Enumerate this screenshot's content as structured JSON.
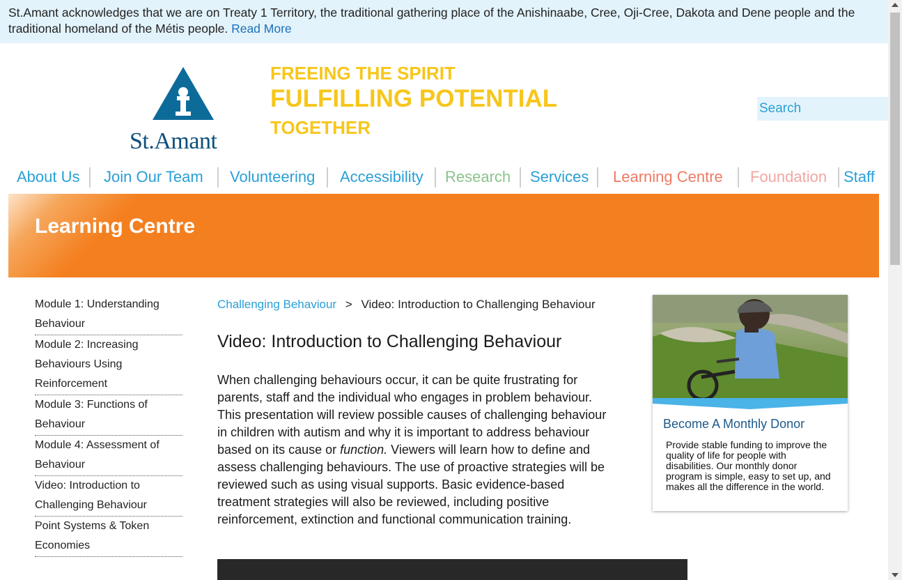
{
  "acknowledgement": {
    "text": "St.Amant acknowledges that we are on Treaty 1 Territory, the traditional gathering place of the Anishinaabe, Cree, Oji-Cree, Dakota and Dene people and the traditional homeland of the Métis people.",
    "link_label": "Read More"
  },
  "logo": {
    "wordmark": "St.Amant"
  },
  "tagline": {
    "line1": "FREEING THE SPIRIT",
    "line2": "FULFILLING POTENTIAL",
    "line3": "TOGETHER"
  },
  "search": {
    "placeholder": "Search"
  },
  "nav": {
    "items": [
      {
        "label": "About Us",
        "color": "#2a9fd6"
      },
      {
        "label": "Join Our Team",
        "color": "#2a9fd6"
      },
      {
        "label": "Volunteering",
        "color": "#2a9fd6"
      },
      {
        "label": "Accessibility",
        "color": "#2a9fd6"
      },
      {
        "label": "Research",
        "color": "#8cc38a"
      },
      {
        "label": "Services",
        "color": "#2a9fd6"
      },
      {
        "label": "Learning Centre",
        "color": "#ef7a64"
      },
      {
        "label": "Foundation",
        "color": "#f2a7a3"
      },
      {
        "label": "Staff",
        "color": "#2a9fd6"
      }
    ]
  },
  "hero": {
    "title": "Learning Centre",
    "color": "#f47f1f"
  },
  "sidebar": {
    "items": [
      {
        "label": "Module 1: Understanding Behaviour"
      },
      {
        "label": "Module 2: Increasing Behaviours Using Reinforcement"
      },
      {
        "label": "Module 3: Functions of Behaviour"
      },
      {
        "label": "Module 4: Assessment of Behaviour"
      },
      {
        "label": "Video: Introduction to Challenging Behaviour"
      },
      {
        "label": "Point Systems & Token Economies"
      }
    ]
  },
  "breadcrumb": {
    "parent": "Challenging Behaviour",
    "separator": ">",
    "current": "Video: Introduction to Challenging Behaviour"
  },
  "main": {
    "title": "Video: Introduction to Challenging Behaviour",
    "body_before": "When challenging behaviours occur, it can be quite frustrating for parents, staff and the individual who engages in problem behaviour. This presentation will review possible causes of challenging behaviour in children with autism and why it is important to address behaviour based on its cause or ",
    "body_emphasis": "function.",
    "body_after": " Viewers will learn how to define and assess challenging behaviours. The use of proactive strategies will be reviewed such as using visual supports. Basic evidence-based treatment strategies will also be reviewed, including positive reinforcement, extinction and functional communication training."
  },
  "promo": {
    "title": "Become A Monthly Donor",
    "text": "Provide stable funding to improve the quality of life for people with disabilities. Our monthly donor program is simple, easy to set up, and makes all the difference in the world."
  }
}
